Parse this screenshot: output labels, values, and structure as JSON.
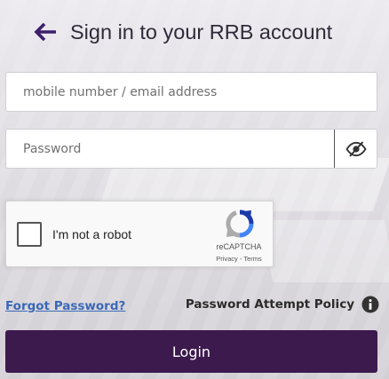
{
  "header": {
    "back_icon": "arrow-left-icon",
    "title": "Sign in to your RRB account"
  },
  "form": {
    "email_placeholder": "mobile number / email address",
    "email_value": "",
    "password_placeholder": "Password",
    "password_value": "",
    "password_toggle_icon": "eye-slash-icon"
  },
  "recaptcha": {
    "label": "I'm not a robot",
    "brand": "reCAPTCHA",
    "privacy": "Privacy",
    "separator": " - ",
    "terms": "Terms",
    "checked": false
  },
  "links": {
    "forgot_password": "Forgot Password?",
    "password_policy": "Password Attempt Policy",
    "policy_icon": "info-icon"
  },
  "actions": {
    "login_label": "Login"
  },
  "colors": {
    "accent": "#3c1a4d",
    "back_arrow": "#3d1f6b",
    "link": "#3a68b8"
  }
}
